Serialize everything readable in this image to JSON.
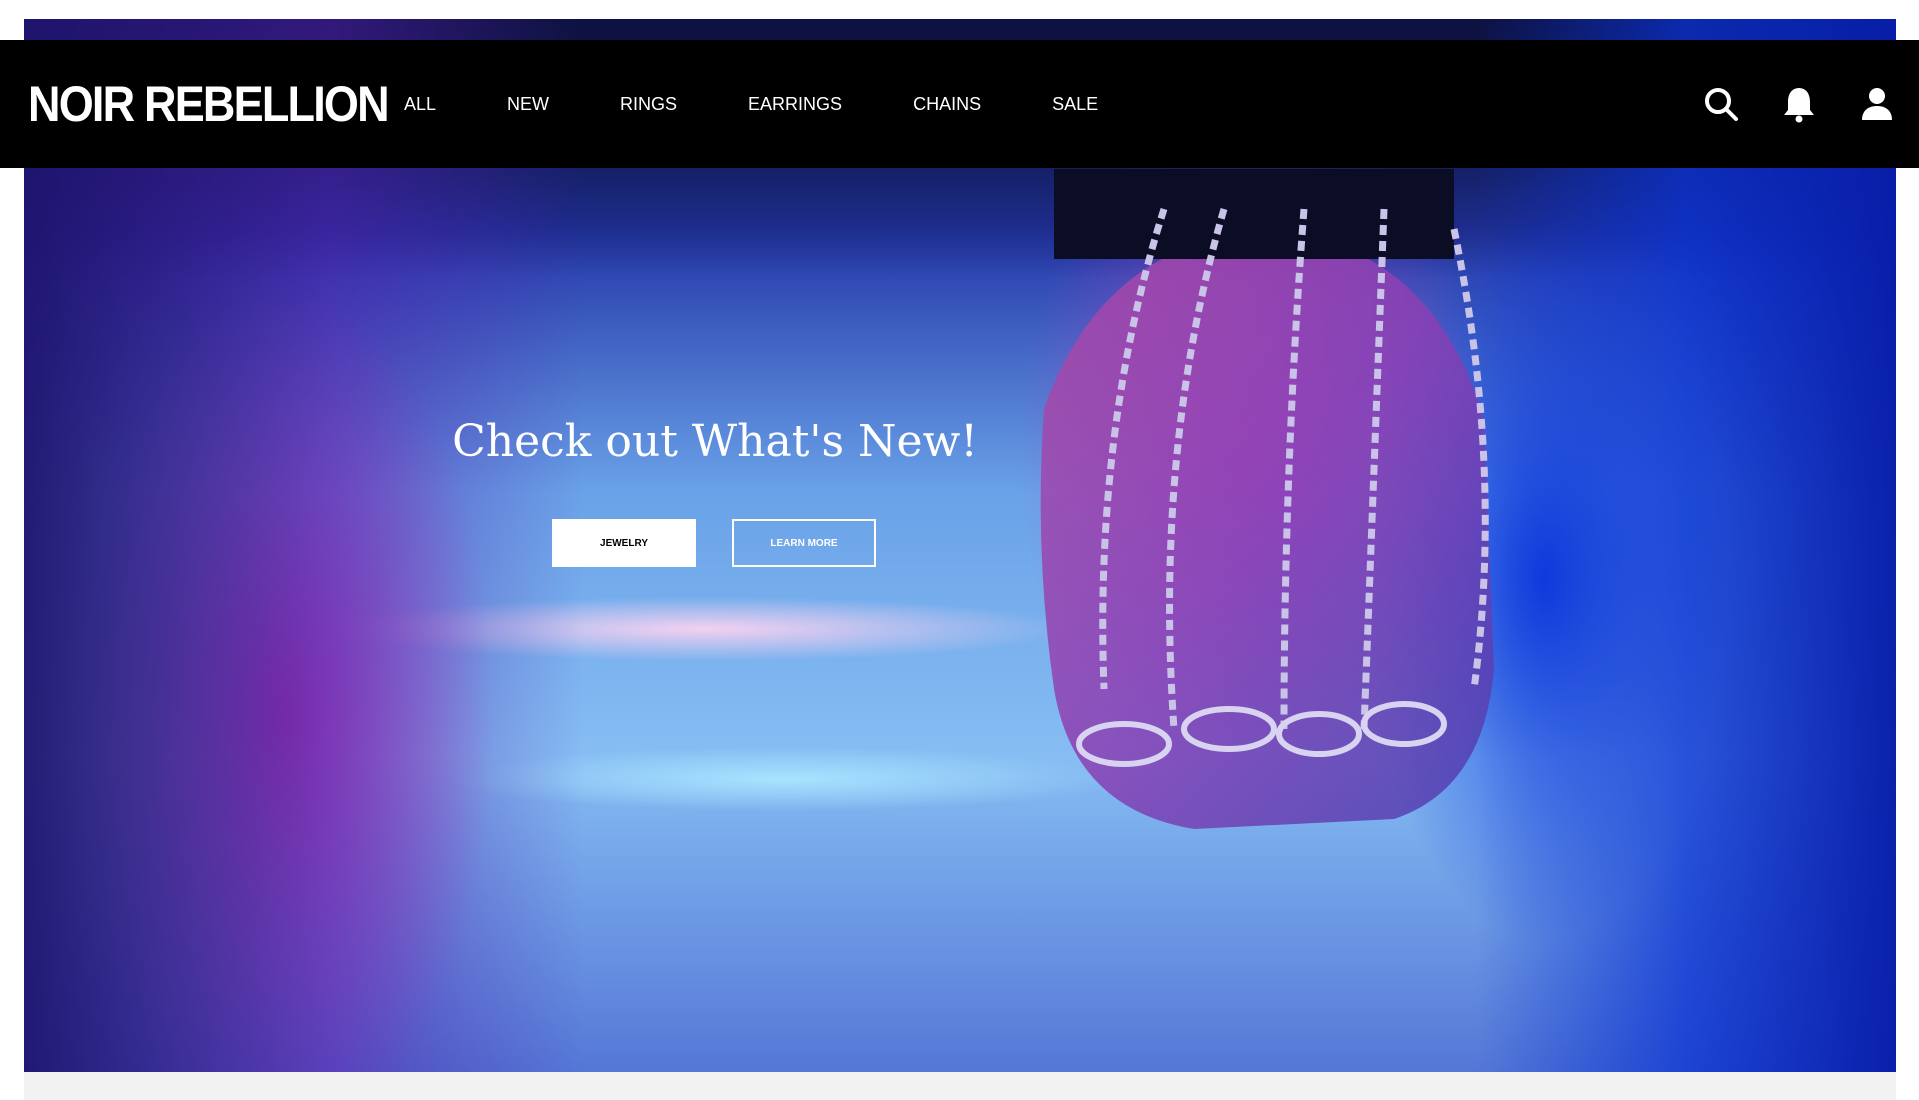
{
  "brand": {
    "logo_text": "NOIR REBELLION"
  },
  "nav": {
    "items": [
      {
        "label": "ALL"
      },
      {
        "label": "NEW"
      },
      {
        "label": "RINGS"
      },
      {
        "label": "EARRINGS"
      },
      {
        "label": "CHAINS"
      },
      {
        "label": "SALE"
      }
    ],
    "icons": [
      "search-icon",
      "bell-icon",
      "user-icon"
    ]
  },
  "hero": {
    "title": "Check out What's New!",
    "primary_button": "JEWELRY",
    "secondary_button": "LEARN MORE"
  },
  "colors": {
    "navbar_bg": "#000000",
    "nav_text": "#ffffff",
    "footer_strip": "#f2f2f2"
  }
}
